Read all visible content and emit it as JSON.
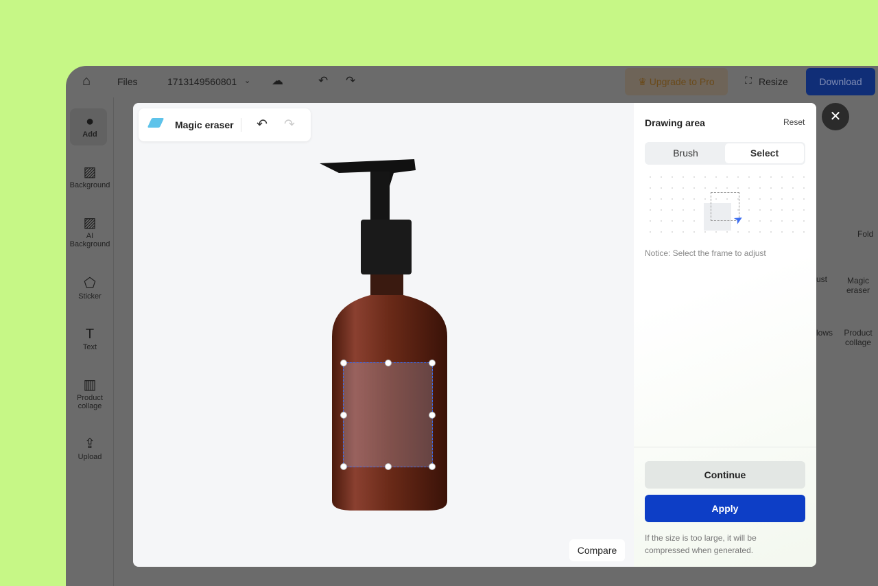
{
  "header": {
    "files": "Files",
    "filename": "1713149560801",
    "upgrade": "Upgrade to Pro",
    "resize": "Resize",
    "download": "Download"
  },
  "sidebar": {
    "items": [
      {
        "label": "Add",
        "icon": "plus-circle-icon"
      },
      {
        "label": "Background",
        "icon": "hatch-icon"
      },
      {
        "label": "AI Background",
        "icon": "sparkle-hatch-icon"
      },
      {
        "label": "Sticker",
        "icon": "sticker-icon"
      },
      {
        "label": "Text",
        "icon": "text-icon"
      },
      {
        "label": "Product collage",
        "icon": "map-icon"
      },
      {
        "label": "Upload",
        "icon": "upload-icon"
      }
    ]
  },
  "right_bg": {
    "fold": "Fold",
    "tools": [
      {
        "label": "ust"
      },
      {
        "label": "Magic eraser"
      },
      {
        "label": "lows"
      },
      {
        "label": "Product collage"
      }
    ]
  },
  "modal": {
    "tool_title": "Magic eraser",
    "compare": "Compare",
    "panel": {
      "title": "Drawing area",
      "reset": "Reset",
      "modes": [
        "Brush",
        "Select"
      ],
      "active_mode": "Select",
      "notice": "Notice: Select the frame to adjust",
      "continue": "Continue",
      "apply": "Apply",
      "footnote": "If the size is too large, it will be compressed when generated."
    }
  },
  "colors": {
    "background": "#c6f786",
    "accent": "#0d3ec6",
    "selection": "#3b6cf0"
  }
}
